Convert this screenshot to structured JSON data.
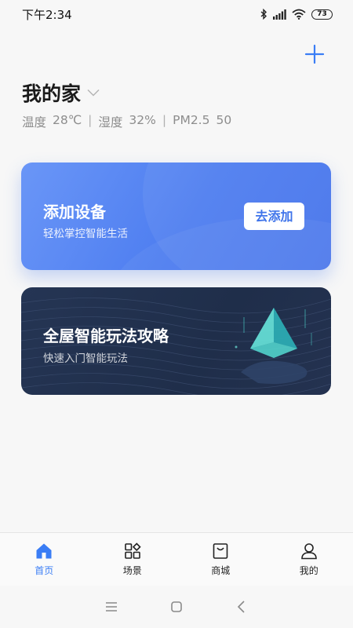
{
  "status_bar": {
    "time": "下午2:34",
    "battery": "73",
    "icons": [
      "bluetooth-icon",
      "signal-icon",
      "wifi-icon",
      "battery-icon"
    ]
  },
  "header": {
    "home_name": "我的家",
    "env": {
      "temperature_label": "温度",
      "temperature_value": "28℃",
      "humidity_label": "湿度",
      "humidity_value": "32%",
      "pm_label": "PM2.5",
      "pm_value": "50",
      "separator": "|"
    }
  },
  "cards": {
    "add_device": {
      "title": "添加设备",
      "subtitle": "轻松掌控智能生活",
      "button_label": "去添加"
    },
    "guide": {
      "title": "全屋智能玩法攻略",
      "subtitle": "快速入门智能玩法"
    }
  },
  "bottom_nav": {
    "items": [
      {
        "label": "首页",
        "icon": "home-icon",
        "active": true
      },
      {
        "label": "场景",
        "icon": "scene-icon",
        "active": false
      },
      {
        "label": "商城",
        "icon": "store-icon",
        "active": false
      },
      {
        "label": "我的",
        "icon": "profile-icon",
        "active": false
      }
    ]
  },
  "colors": {
    "accent": "#3a7df5",
    "card_blue": "#4d7df0",
    "card_navy": "#223250"
  }
}
